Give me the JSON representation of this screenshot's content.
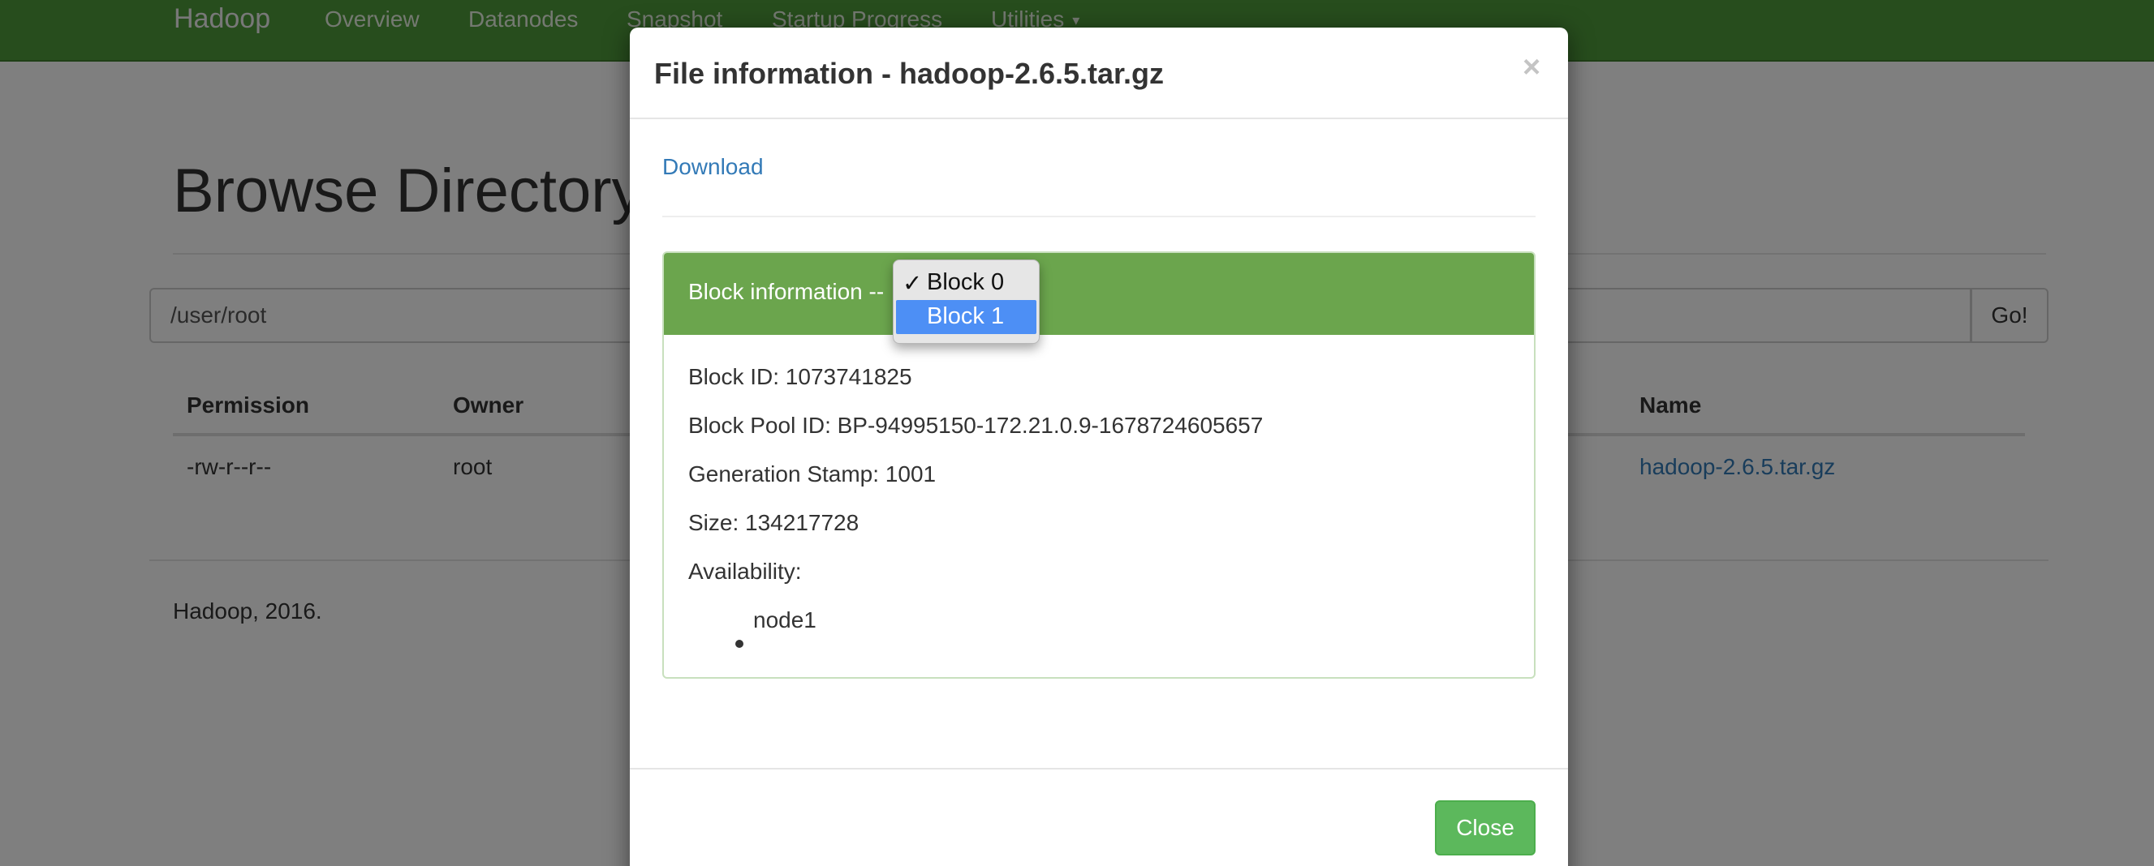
{
  "navbar": {
    "brand": "Hadoop",
    "items": [
      "Overview",
      "Datanodes",
      "Snapshot",
      "Startup Progress",
      "Utilities"
    ],
    "caret_icon": "caret-down-icon"
  },
  "page": {
    "title": "Browse Directory",
    "path_value": "/user/root",
    "go_label": "Go!",
    "table": {
      "headers": [
        "Permission",
        "Owner",
        "Name"
      ],
      "rows": [
        {
          "permission": "-rw-r--r--",
          "owner": "root",
          "name": "hadoop-2.6.5.tar.gz"
        }
      ]
    },
    "footer": "Hadoop, 2016."
  },
  "modal": {
    "title": "File information - hadoop-2.6.5.tar.gz",
    "close_x": "×",
    "download_label": "Download",
    "block_info_label": "Block information --",
    "block_options": [
      "Block 0",
      "Block 1"
    ],
    "selected_option": "Block 0",
    "highlighted_option": "Block 1",
    "check_icon": "✓",
    "block_id": "Block ID: 1073741825",
    "block_pool_id": "Block Pool ID: BP-94995150-172.21.0.9-1678724605657",
    "generation_stamp": "Generation Stamp: 1001",
    "size": "Size: 134217728",
    "availability_label": "Availability:",
    "availability_nodes": [
      "node1"
    ],
    "close_button": "Close"
  },
  "colors": {
    "navbar": "#4f9a3a",
    "panel_heading": "#6ba54d",
    "highlight": "#4d8ff5",
    "link": "#337ab7",
    "close_button": "#5cb85c"
  }
}
